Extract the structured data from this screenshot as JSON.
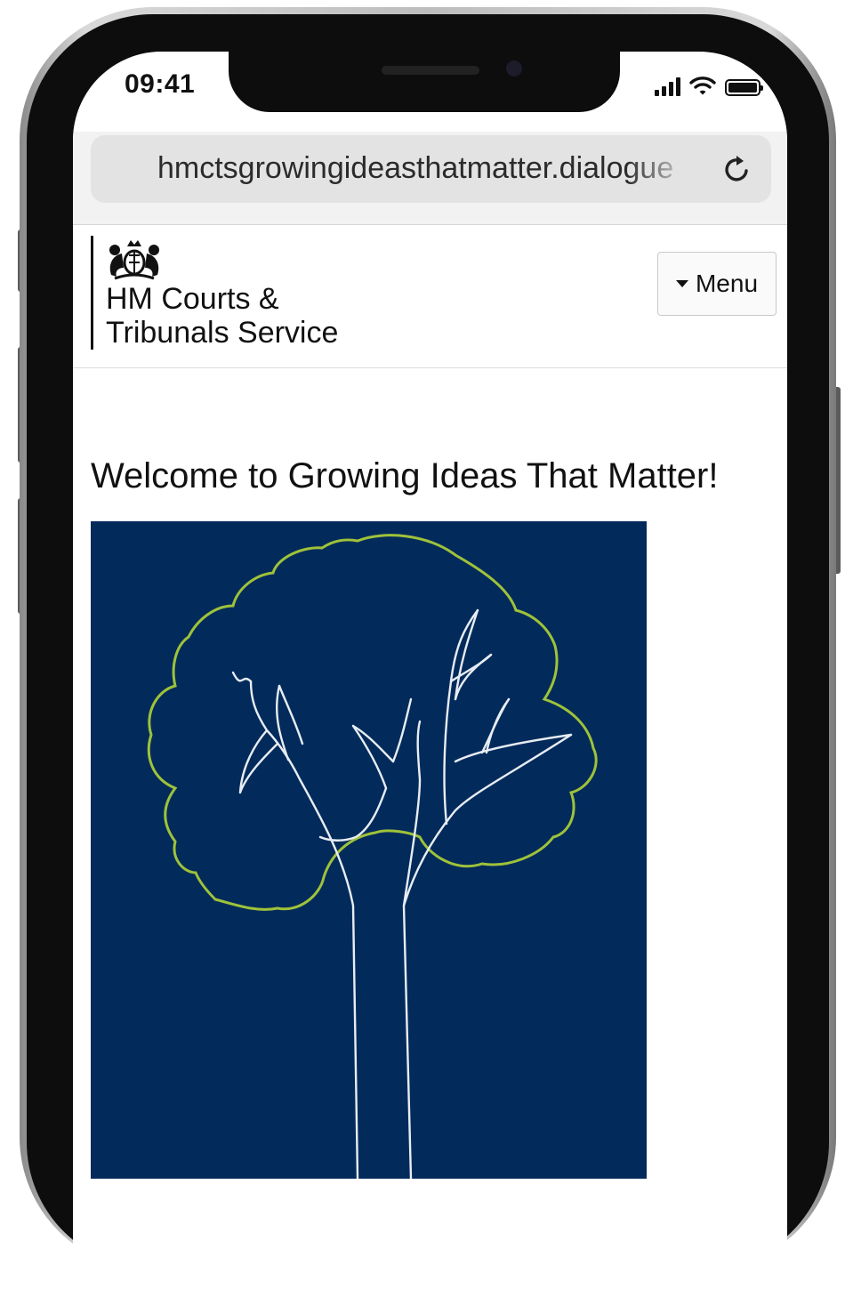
{
  "status_bar": {
    "time": "09:41",
    "icons": [
      "cellular-signal-icon",
      "wifi-icon",
      "battery-icon"
    ]
  },
  "browser": {
    "url": "hmctsgrowingideasthatmatter.dialogue",
    "reload_icon": "reload-icon"
  },
  "header": {
    "logo_icon": "royal-crest-icon",
    "logo_line_1": "HM Courts &",
    "logo_line_2": "Tribunals Service",
    "menu_label": "Menu",
    "menu_icon": "caret-down-icon"
  },
  "main": {
    "title": "Welcome to Growing Ideas That Matter!",
    "hero_image": "tree-illustration",
    "hero_background": "#022b5b",
    "canopy_color": "#9fc23a",
    "trunk_color": "#e8edf3"
  }
}
